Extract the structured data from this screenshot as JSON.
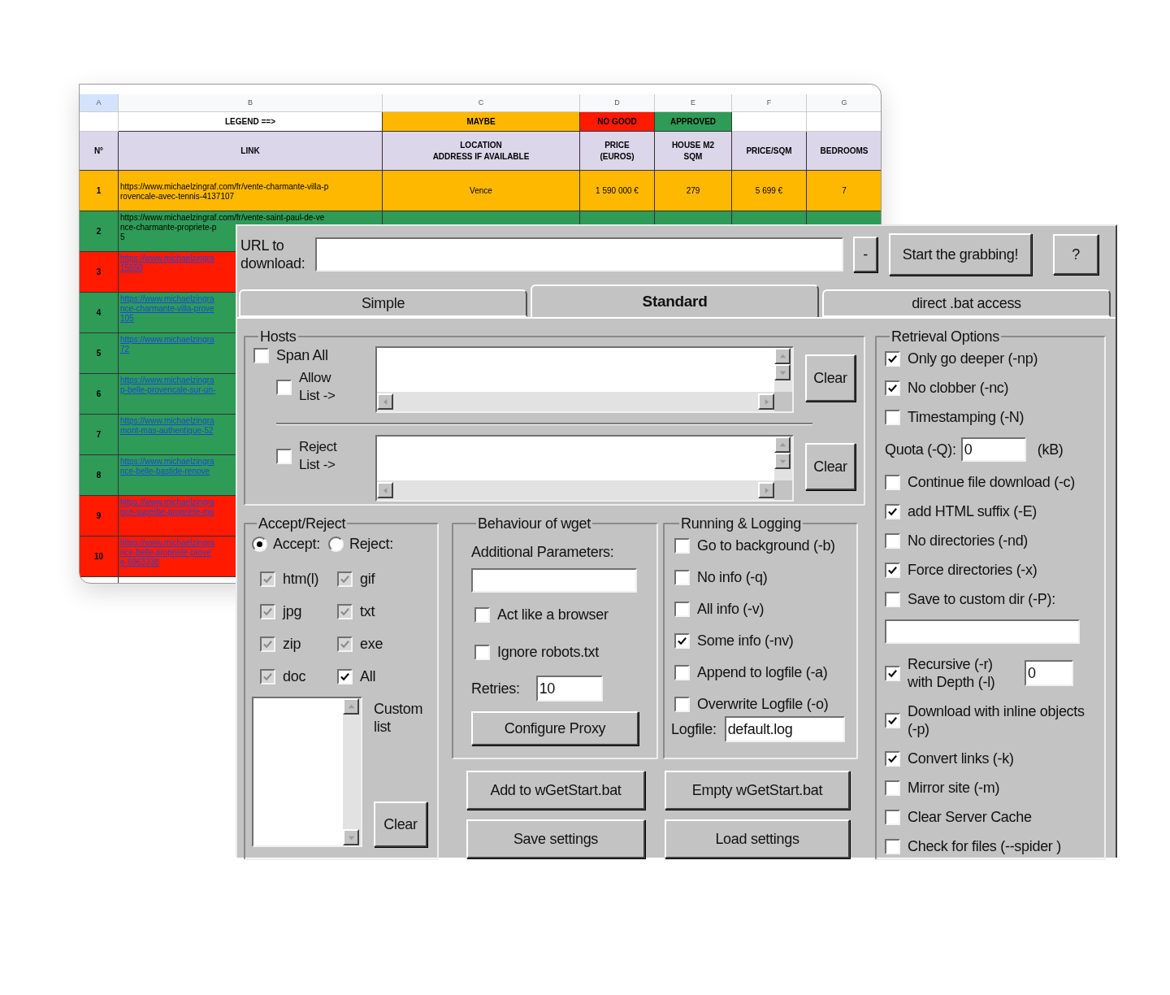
{
  "spreadsheet": {
    "column_letters": [
      "A",
      "B",
      "C",
      "D",
      "E",
      "F",
      "G"
    ],
    "legend": {
      "label": "LEGEND ==>",
      "items": [
        {
          "text": "MAYBE",
          "color": "#ffb800"
        },
        {
          "text": "NO GOOD",
          "color": "#ff1a00"
        },
        {
          "text": "APPROVED",
          "color": "#2e9b57"
        }
      ]
    },
    "headers": [
      "N°",
      "LINK",
      "LOCATION\nADDRESS IF AVAILABLE",
      "PRICE\n(EUROS)",
      "HOUSE M2\nSQM",
      "PRICE/SQM",
      "BEDROOMS"
    ],
    "rows": [
      {
        "number": "1",
        "color": "#ffb800",
        "hyperlink": false,
        "link_lines": [
          "https://www.michaelzingraf.com/fr/vente-charmante-villa-p",
          "rovencale-avec-tennis-4137107"
        ],
        "location": "Vence",
        "price": "1 590 000 €",
        "house_m2": "279",
        "price_sqm": "5 699 €",
        "bedrooms": "7"
      },
      {
        "number": "2",
        "color": "#2e9b57",
        "hyperlink": false,
        "link_lines": [
          "https://www.michaelzingraf.com/fr/vente-saint-paul-de-ve",
          "nce-charmante-propriete-p",
          "5"
        ]
      },
      {
        "number": "3",
        "color": "#ff1a00",
        "hyperlink": true,
        "link_lines": [
          "https://www.michaelzingra",
          "15550"
        ]
      },
      {
        "number": "4",
        "color": "#2e9b57",
        "hyperlink": true,
        "link_lines": [
          "https://www.michaelzingra",
          "nce-charmante-villa-prove",
          "105"
        ]
      },
      {
        "number": "5",
        "color": "#2e9b57",
        "hyperlink": true,
        "link_lines": [
          "https://www.michaelzingra",
          "72"
        ]
      },
      {
        "number": "6",
        "color": "#2e9b57",
        "hyperlink": true,
        "link_lines": [
          "https://www.michaelzingra",
          "p-belle-provencale-sur-un-"
        ]
      },
      {
        "number": "7",
        "color": "#2e9b57",
        "hyperlink": true,
        "link_lines": [
          "https://www.michaelzingra",
          "mont-mas-authentique-52"
        ]
      },
      {
        "number": "8",
        "color": "#2e9b57",
        "hyperlink": true,
        "link_lines": [
          "https://www.michaelzingra",
          "nce-belle-bastide-renove"
        ]
      },
      {
        "number": "9",
        "color": "#ff1a00",
        "hyperlink": true,
        "link_lines": [
          "https://www.michaelzingra",
          "nce-superbe-propriete-mo"
        ]
      },
      {
        "number": "10",
        "color": "#ff1a00",
        "hyperlink": true,
        "link_lines": [
          "https://www.michaelzingra",
          "nce-belle-propriete-prove",
          "e-6963338"
        ]
      }
    ]
  },
  "dialog": {
    "url_label": "URL to download:",
    "minus_button": "-",
    "start_button": "Start the grabbing!",
    "help_button": "?",
    "tabs": [
      {
        "label": "Simple",
        "selected": false
      },
      {
        "label": "Standard",
        "selected": true
      },
      {
        "label": "direct .bat access",
        "selected": false
      }
    ],
    "hosts": {
      "title": "Hosts",
      "span_all": {
        "label": "Span All",
        "checked": false
      },
      "allow": {
        "label": "Allow List ->",
        "checked": false
      },
      "allow_clear": "Clear",
      "reject": {
        "label": "Reject List ->",
        "checked": false
      },
      "reject_clear": "Clear"
    },
    "accept_reject": {
      "title": "Accept/Reject",
      "modes": [
        {
          "label": "Accept:",
          "selected": true
        },
        {
          "label": "Reject:",
          "selected": false
        }
      ],
      "types": [
        {
          "label": "htm(l)",
          "checked": true,
          "disabled": true
        },
        {
          "label": "gif",
          "checked": true,
          "disabled": true
        },
        {
          "label": "jpg",
          "checked": true,
          "disabled": true
        },
        {
          "label": "txt",
          "checked": true,
          "disabled": true
        },
        {
          "label": "zip",
          "checked": true,
          "disabled": true
        },
        {
          "label": "exe",
          "checked": true,
          "disabled": true
        },
        {
          "label": "doc",
          "checked": true,
          "disabled": true
        },
        {
          "label": "All",
          "checked": true,
          "disabled": false
        }
      ],
      "custom_label": "Custom list",
      "clear": "Clear"
    },
    "behaviour": {
      "title": "Behaviour of wget",
      "params_label": "Additional Parameters:",
      "options": [
        {
          "label": "Act like a browser",
          "checked": false
        },
        {
          "label": "Ignore robots.txt",
          "checked": false
        }
      ],
      "retries_label": "Retries:",
      "retries_value": "10",
      "proxy_button": "Configure Proxy"
    },
    "logging": {
      "title": "Running & Logging",
      "options": [
        {
          "label": "Go to background (-b)",
          "checked": false
        },
        {
          "label": "No info (-q)",
          "checked": false
        },
        {
          "label": "All info (-v)",
          "checked": false
        },
        {
          "label": "Some info (-nv)",
          "checked": true
        },
        {
          "label": "Append to logfile (-a)",
          "checked": false
        },
        {
          "label": "Overwrite Logfile (-o)",
          "checked": false
        }
      ],
      "logfile_label": "Logfile:",
      "logfile_value": "default.log"
    },
    "buttons": [
      "Add to wGetStart.bat",
      "Empty wGetStart.bat",
      "Save settings",
      "Load settings"
    ],
    "retrieval": {
      "title": "Retrieval Options",
      "items": [
        {
          "kind": "check",
          "label": "Only go deeper (-np)",
          "checked": true
        },
        {
          "kind": "check",
          "label": "No clobber (-nc)",
          "checked": true
        },
        {
          "kind": "check",
          "label": "Timestamping (-N)",
          "checked": false
        },
        {
          "kind": "field",
          "label": "Quota (-Q):",
          "value": "0",
          "unit": "(kB)"
        },
        {
          "kind": "check",
          "label": "Continue file download (-c)",
          "checked": false
        },
        {
          "kind": "check",
          "label": "add HTML suffix (-E)",
          "checked": true
        },
        {
          "kind": "check",
          "label": "No directories (-nd)",
          "checked": false
        },
        {
          "kind": "check",
          "label": "Force directories (-x)",
          "checked": true
        },
        {
          "kind": "check",
          "label": "Save to custom dir (-P):",
          "checked": false
        },
        {
          "kind": "entry"
        },
        {
          "kind": "check_value",
          "label": "Recursive (-r) with Depth (-l)",
          "checked": true,
          "value": "0"
        },
        {
          "kind": "check",
          "label": "Download with inline objects (-p)",
          "checked": true
        },
        {
          "kind": "check",
          "label": "Convert links (-k)",
          "checked": true
        },
        {
          "kind": "check",
          "label": "Mirror site (-m)",
          "checked": false
        },
        {
          "kind": "check",
          "label": "Clear Server Cache",
          "checked": false
        },
        {
          "kind": "check",
          "label": "Check for files (--spider )",
          "checked": false
        }
      ]
    }
  }
}
